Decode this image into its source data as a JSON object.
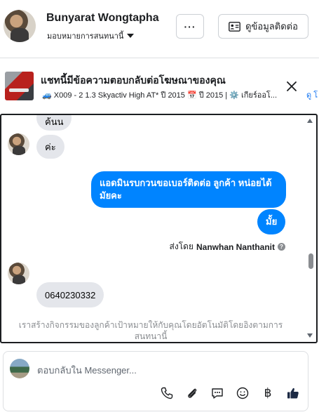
{
  "header": {
    "name": "Bunyarat Wongtapha",
    "subtitle": "มอบหมายการสนทนานี้",
    "more_label": "···",
    "contact_label": "ดูข้อมูลติดต่อ"
  },
  "banner": {
    "title": "แชทนี้มีข้อความตอบกลับต่อโฆษณาของคุณ",
    "details": "🚙 X009 - 2 1.3 Skyactiv High AT* ปี 2015 📅 ปี 2015 | ⚙️ เกียร์ออโ...",
    "link_text": "ดู โ"
  },
  "conversation": {
    "messages": [
      {
        "from": "customer",
        "text": "ค้นน"
      },
      {
        "from": "customer",
        "text": "ค่ะ"
      },
      {
        "from": "page",
        "text": "แอดมินรบกวนขอเบอร์ติดต่อ ลูกค้า  หน่อยได้มัยคะ"
      },
      {
        "from": "page",
        "text": "มั้ย"
      },
      {
        "from": "customer",
        "text": "0640230332"
      }
    ],
    "sent_by_prefix": "ส่งโดย",
    "sent_by_name": "Nanwhan Nanthanit",
    "info_icon": "?",
    "auto_note": "เราสร้างกิจกรรมของลูกค้าเป้าหมายให้กับคุณโดยอัตโนมัติโดยอิงตามการสนทนานี้"
  },
  "reply": {
    "placeholder": "ตอบกลับใน Messenger...",
    "baht_symbol": "฿"
  }
}
